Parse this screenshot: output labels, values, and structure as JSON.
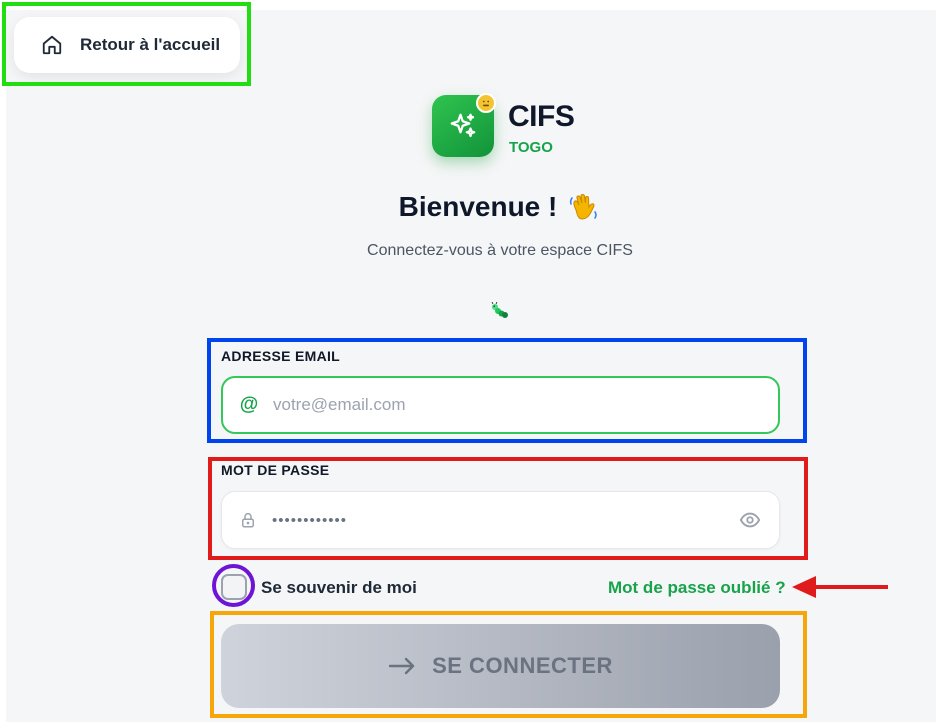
{
  "nav": {
    "home_label": "Retour à l'accueil"
  },
  "brand": {
    "name": "CIFS",
    "subtitle": "TOGO"
  },
  "welcome": {
    "title": "Bienvenue !",
    "subtitle": "Connectez-vous à votre espace CIFS"
  },
  "form": {
    "email_label": "ADRESSE EMAIL",
    "email_placeholder": "votre@email.com",
    "email_icon": "@",
    "password_label": "MOT DE PASSE",
    "password_value": "••••••••••••",
    "remember_label": "Se souvenir de moi",
    "forgot_label": "Mot de passe oublié ?",
    "submit_label": "SE CONNECTER"
  },
  "icons": {
    "home": "home-icon",
    "logo": "sparkle-icon",
    "badge": "emoji-badge-icon",
    "wave": "waving-hand-icon",
    "caterpillar": "caterpillar-icon",
    "email": "at-sign-icon",
    "password": "lock-icon",
    "reveal": "eye-icon",
    "submit": "arrow-right-icon"
  },
  "colors": {
    "brand_green": "#16a34a",
    "annotation_green": "#22dd11",
    "annotation_blue": "#0044ee",
    "annotation_red": "#e01b1b",
    "annotation_purple": "#6d14d6",
    "annotation_orange": "#f6a609"
  }
}
